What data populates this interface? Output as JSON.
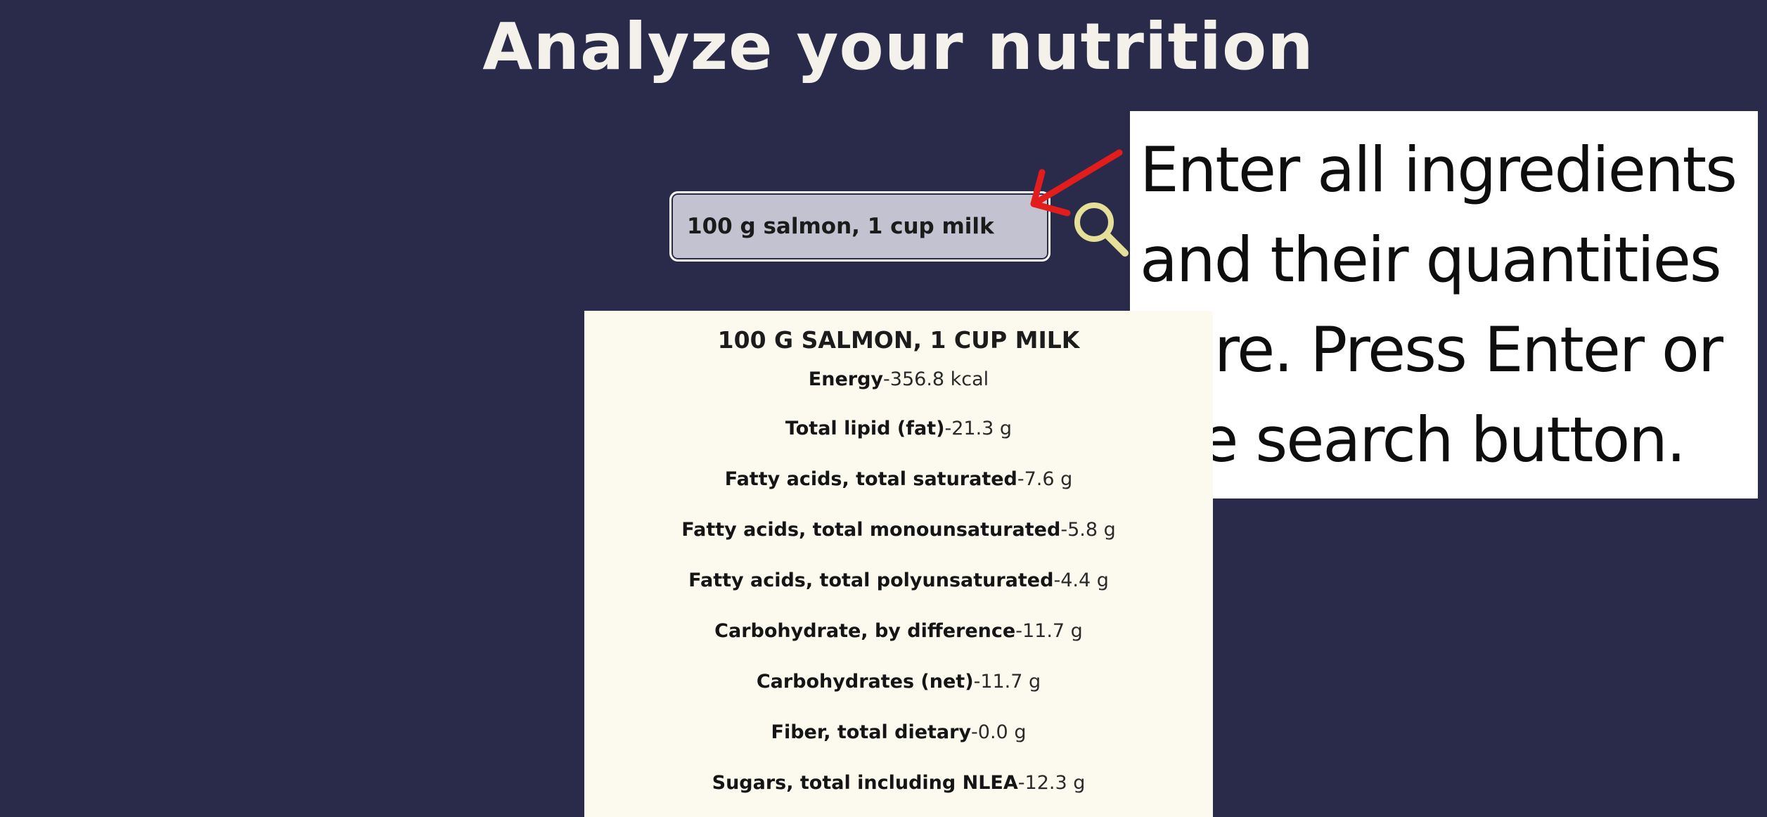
{
  "page": {
    "title": "Analyze your nutrition"
  },
  "search": {
    "value": "100 g salmon, 1 cup milk",
    "icon": "search-icon",
    "icon_color": "#e6df98"
  },
  "annotation": {
    "lines": [
      "Enter all ingredients",
      "and their quantities",
      "here. Press Enter or",
      "the search button."
    ],
    "arrow_color": "#e31c1c"
  },
  "results": {
    "heading": "100 G SALMON, 1 CUP MILK",
    "separator": " - ",
    "nutrients": [
      {
        "name": "Energy",
        "value": "356.8 kcal"
      },
      {
        "name": "Total lipid (fat)",
        "value": "21.3 g"
      },
      {
        "name": "Fatty acids, total saturated",
        "value": "7.6 g"
      },
      {
        "name": "Fatty acids, total monounsaturated",
        "value": "5.8 g"
      },
      {
        "name": "Fatty acids, total polyunsaturated",
        "value": "4.4 g"
      },
      {
        "name": "Carbohydrate, by difference",
        "value": "11.7 g"
      },
      {
        "name": "Carbohydrates (net)",
        "value": "11.7 g"
      },
      {
        "name": "Fiber, total dietary",
        "value": "0.0 g"
      },
      {
        "name": "Sugars, total including NLEA",
        "value": "12.3 g"
      }
    ]
  },
  "colors": {
    "background": "#2a2b4b",
    "card": "#fcfaee",
    "title": "#f3f1ea",
    "input": "#c3c2d0"
  }
}
